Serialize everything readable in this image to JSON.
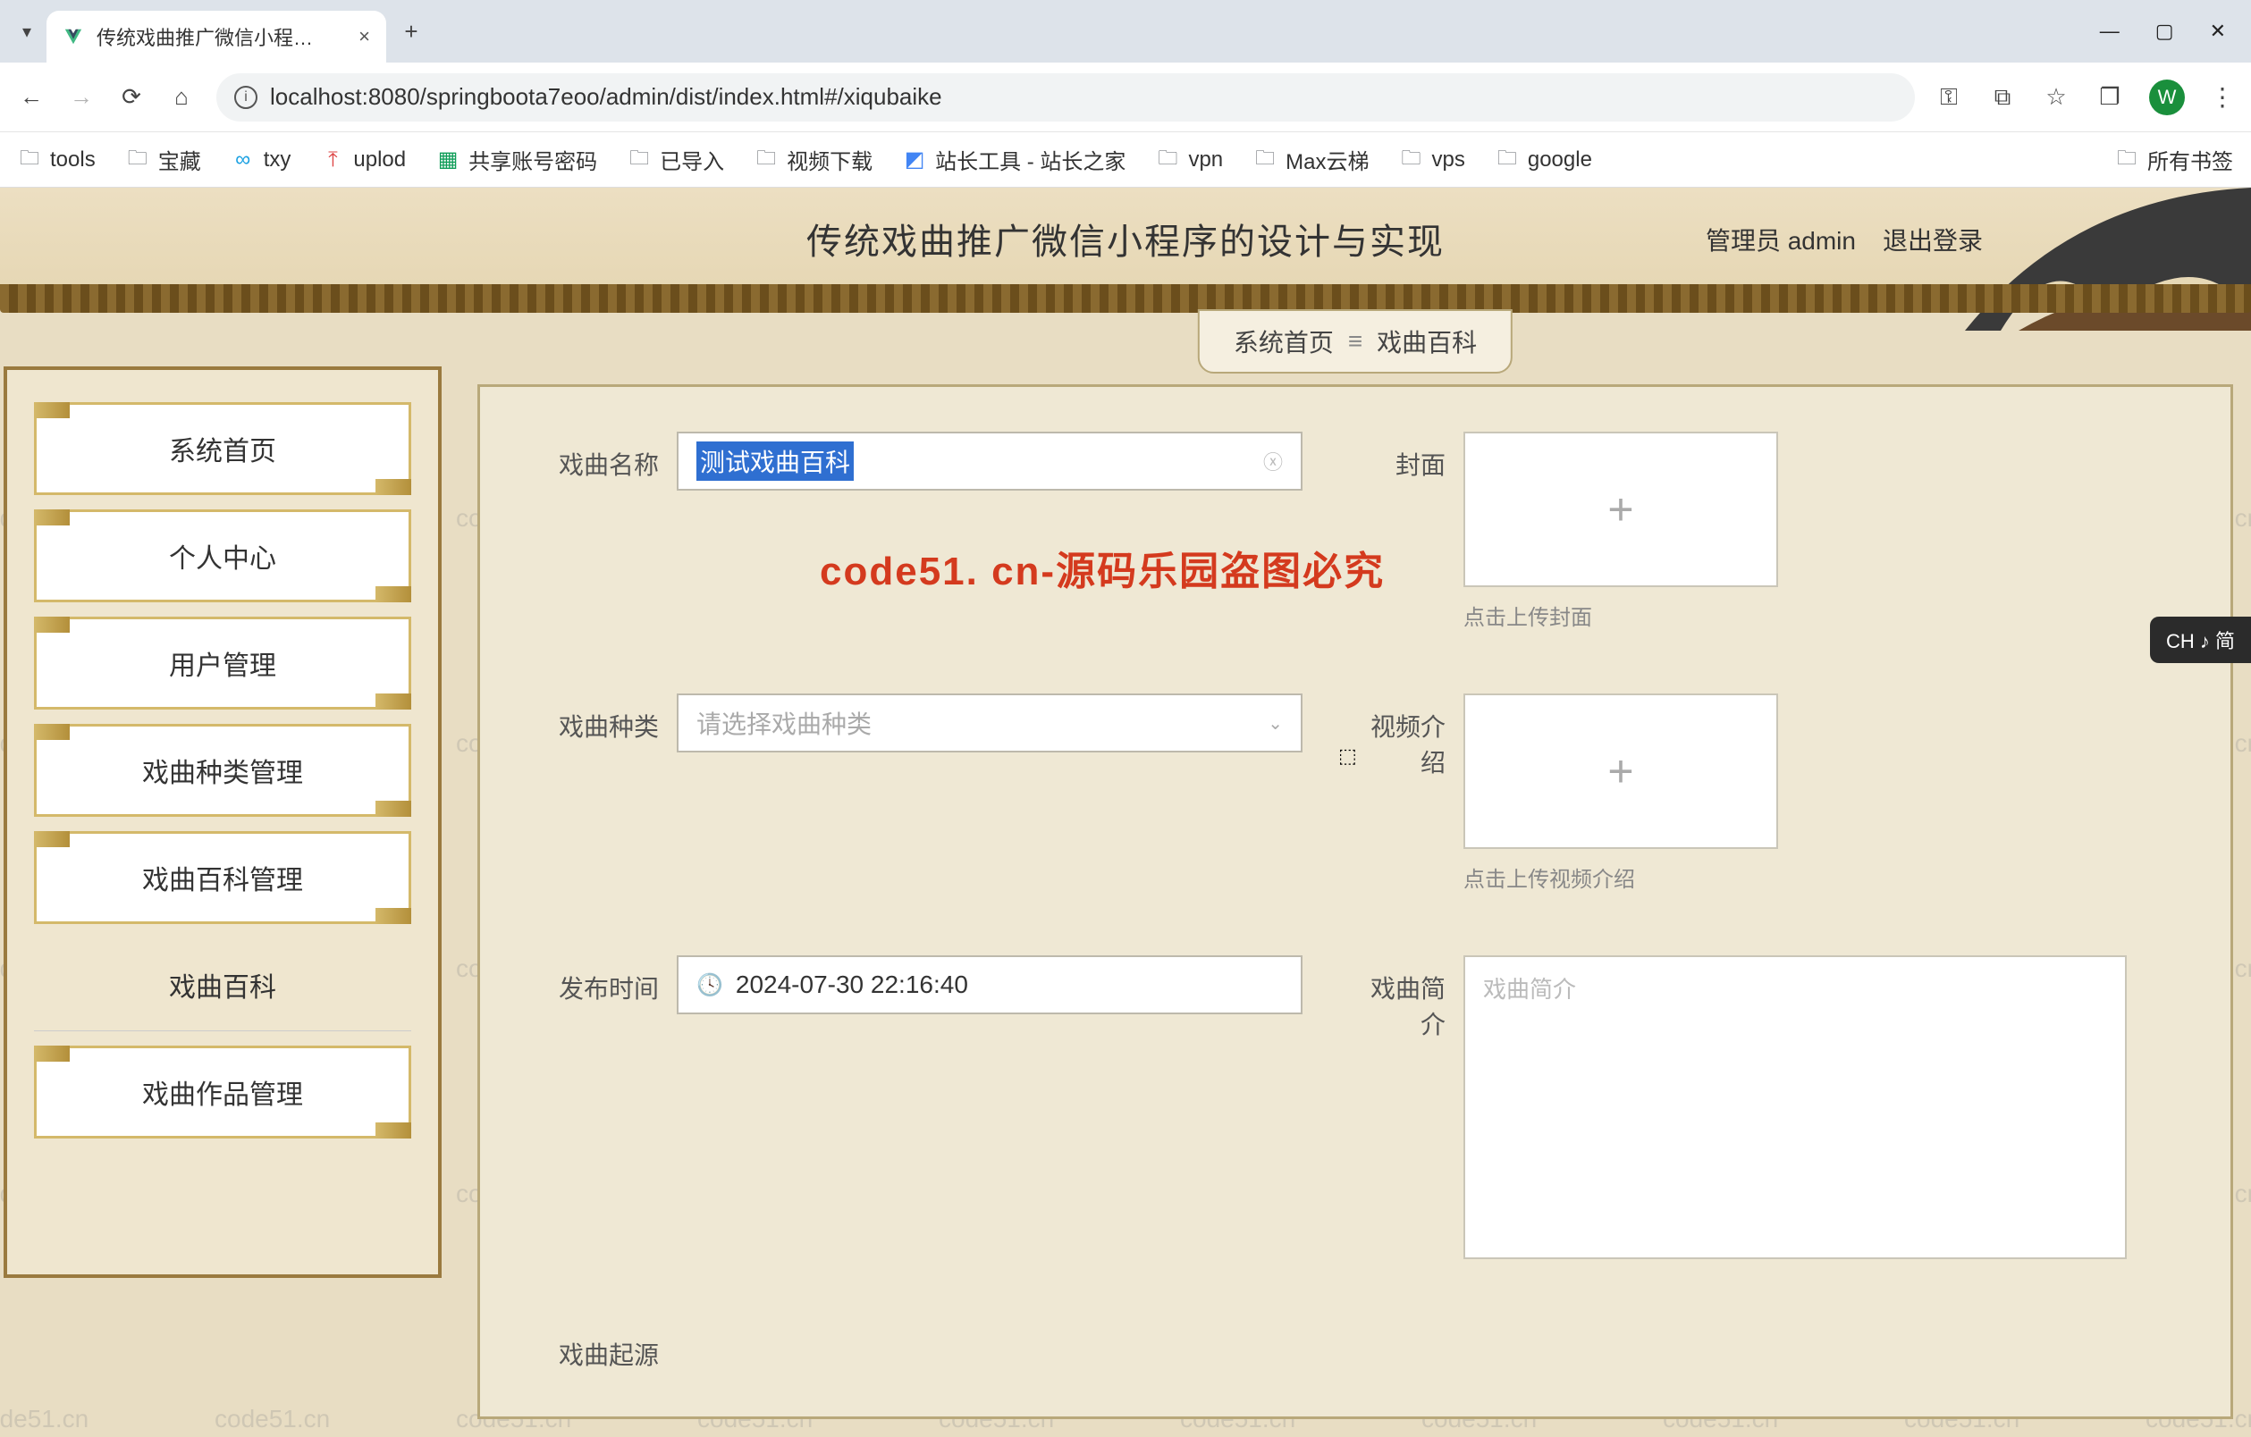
{
  "browser": {
    "tab_title": "传统戏曲推广微信小程序的设计",
    "url": "localhost:8080/springboota7eoo/admin/dist/index.html#/xiqubaike",
    "avatar_letter": "W"
  },
  "bookmarks": {
    "items": [
      "tools",
      "宝藏",
      "txy",
      "uplod",
      "共享账号密码",
      "已导入",
      "视频下载",
      "站长工具 - 站长之家",
      "vpn",
      "Max云梯",
      "vps",
      "google"
    ],
    "all": "所有书签"
  },
  "header": {
    "title": "传统戏曲推广微信小程序的设计与实现",
    "admin_label": "管理员 admin",
    "logout": "退出登录"
  },
  "sidebar": {
    "items": [
      {
        "label": "系统首页"
      },
      {
        "label": "个人中心"
      },
      {
        "label": "用户管理"
      },
      {
        "label": "戏曲种类管理"
      },
      {
        "label": "戏曲百科管理"
      },
      {
        "label": "戏曲百科"
      },
      {
        "label": "戏曲作品管理"
      }
    ]
  },
  "crumb": {
    "home": "系统首页",
    "current": "戏曲百科"
  },
  "form": {
    "name_label": "戏曲名称",
    "name_value": "测试戏曲百科",
    "cover_label": "封面",
    "cover_hint": "点击上传封面",
    "type_label": "戏曲种类",
    "type_placeholder": "请选择戏曲种类",
    "video_label": "视频介绍",
    "video_hint": "点击上传视频介绍",
    "time_label": "发布时间",
    "time_value": "2024-07-30 22:16:40",
    "intro_label": "戏曲简介",
    "intro_placeholder": "戏曲简介",
    "origin_label": "戏曲起源"
  },
  "watermark": {
    "red": "code51. cn-源码乐园盗图必究",
    "grey": "code51.cn"
  },
  "ime": {
    "text": "CH ♪ 简"
  }
}
